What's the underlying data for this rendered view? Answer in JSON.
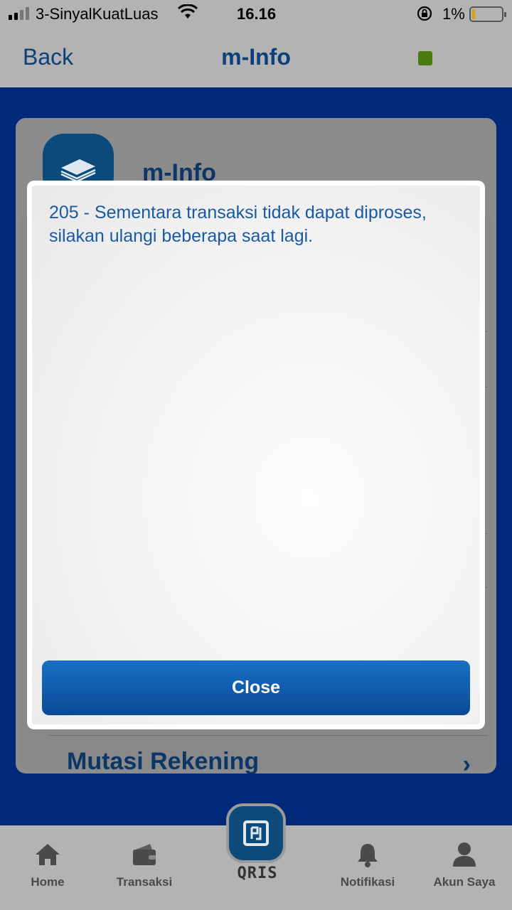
{
  "status_bar": {
    "carrier": "3-SinyalKuatLuas",
    "time": "16.16",
    "battery_percent": "1%",
    "battery_level": 0.01,
    "icons": [
      "signal-icon",
      "wifi-icon",
      "rotation-lock-icon",
      "battery-icon"
    ]
  },
  "nav": {
    "back_label": "Back",
    "title": "m-Info",
    "status_color": "#4a7a10"
  },
  "background_card": {
    "title": "m-Info",
    "item_label": "Mutasi Rekening"
  },
  "dialog": {
    "message": "205 - Sementara transaksi tidak dapat diproses, silakan ulangi beberapa saat lagi.",
    "close_label": "Close"
  },
  "tab_bar": {
    "tabs": [
      {
        "label": "Home",
        "icon": "home-icon"
      },
      {
        "label": "Transaksi",
        "icon": "wallet-icon"
      },
      {
        "label": "Notifikasi",
        "icon": "bell-icon"
      },
      {
        "label": "Akun Saya",
        "icon": "user-icon"
      }
    ],
    "qris_label": "QRIS"
  },
  "colors": {
    "accent": "#0d3f7a",
    "message_text": "#1a5aa5",
    "button": "#0a4a97",
    "backdrop": "#00297a"
  }
}
